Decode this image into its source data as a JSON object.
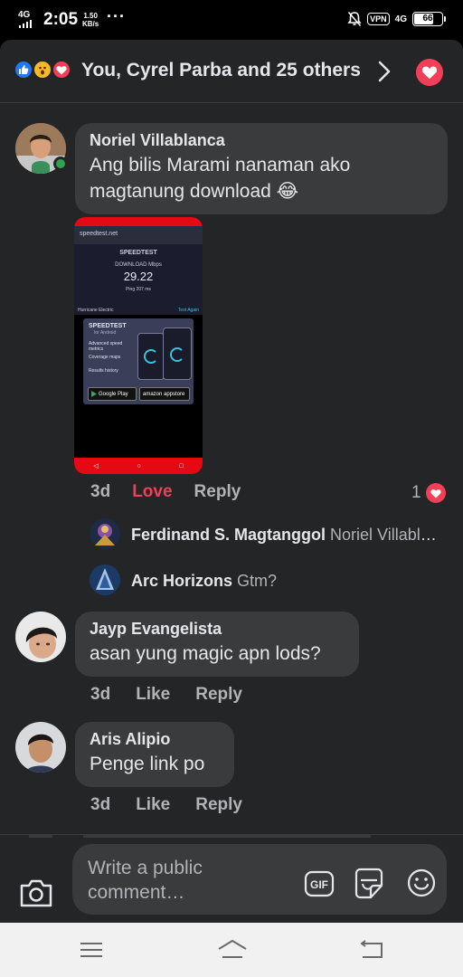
{
  "status_bar": {
    "network": "4G",
    "time": "2:05",
    "speed_value": "1.50",
    "speed_unit": "KB/s",
    "dots": "···",
    "vpn": "VPN",
    "network_right": "4G",
    "battery": "66"
  },
  "header": {
    "title": "You, Cyrel Parba and 25 others",
    "reactions": [
      "like-icon",
      "wow-icon",
      "love-icon"
    ]
  },
  "comments": [
    {
      "author": "Noriel Villablanca",
      "text": "Ang bilis Marami nanaman ako magtanung download 😂",
      "time": "3d",
      "like_label": "Love",
      "reply_label": "Reply",
      "reaction_count": "1",
      "online": true,
      "replies": [
        {
          "author": "Ferdinand S. Magtanggol",
          "text": "Noriel Villablanca"
        },
        {
          "author": "Arc Horizons",
          "text": "Gtm?"
        }
      ],
      "attachment": {
        "url": "speedtest.net",
        "logo": "SPEEDTEST",
        "label": "DOWNLOAD Mbps",
        "value": "29.22",
        "ping": "Ping 207 ms",
        "provider": "Hurricane Electric",
        "test_again": "Test Again",
        "ad_title": "SPEEDTEST",
        "ad_subtitle": "for Android",
        "ad_features": [
          "Advanced speed metrics",
          "Coverage maps",
          "Results history"
        ],
        "store_1": "Google Play",
        "store_2": "amazon appstore"
      }
    },
    {
      "author": "Jayp Evangelista",
      "text": "asan yung magic apn lods?",
      "time": "3d",
      "like_label": "Like",
      "reply_label": "Reply"
    },
    {
      "author": "Aris Alipio",
      "text": "Penge link po",
      "time": "3d",
      "like_label": "Like",
      "reply_label": "Reply"
    }
  ],
  "composer": {
    "placeholder": "Write a public comment…",
    "gif_label": "GIF"
  },
  "colors": {
    "background": "#242526",
    "bubble": "#3a3b3c",
    "love": "#f33e58",
    "like": "#2078f4",
    "online": "#31a24c"
  }
}
